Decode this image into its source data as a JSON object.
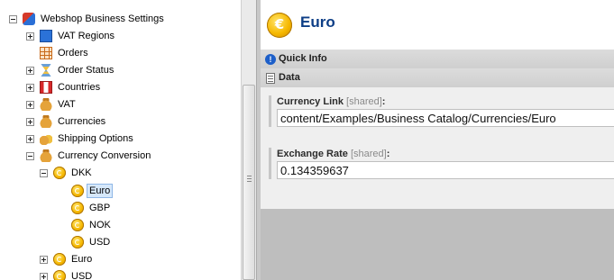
{
  "tree": {
    "items": [
      {
        "label": "Webshop Business Settings",
        "expander": "minus",
        "icon": "settings-icon"
      },
      {
        "label": "VAT Regions",
        "expander": "plus",
        "icon": "vat-regions-icon"
      },
      {
        "label": "Orders",
        "expander": "none",
        "icon": "orders-icon"
      },
      {
        "label": "Order Status",
        "expander": "plus",
        "icon": "order-status-icon"
      },
      {
        "label": "Countries",
        "expander": "plus",
        "icon": "countries-icon"
      },
      {
        "label": "VAT",
        "expander": "plus",
        "icon": "vat-icon"
      },
      {
        "label": "Currencies",
        "expander": "plus",
        "icon": "currencies-icon"
      },
      {
        "label": "Shipping Options",
        "expander": "plus",
        "icon": "shipping-options-icon"
      },
      {
        "label": "Currency Conversion",
        "expander": "minus",
        "icon": "currency-conversion-icon"
      },
      {
        "label": "DKK",
        "expander": "minus",
        "icon": "coin-icon"
      },
      {
        "label": "Euro",
        "expander": "none",
        "icon": "coin-icon",
        "selected": true
      },
      {
        "label": "GBP",
        "expander": "none",
        "icon": "coin-icon"
      },
      {
        "label": "NOK",
        "expander": "none",
        "icon": "coin-icon"
      },
      {
        "label": "USD",
        "expander": "none",
        "icon": "coin-icon"
      },
      {
        "label": "Euro",
        "expander": "plus",
        "icon": "coin-icon"
      },
      {
        "label": "USD",
        "expander": "plus",
        "icon": "coin-icon"
      }
    ]
  },
  "header": {
    "title": "Euro",
    "icon": "euro-coin-icon"
  },
  "sections": {
    "quick_info": "Quick Info",
    "data": "Data"
  },
  "fields": {
    "currency_link": {
      "label": "Currency Link",
      "shared": "[shared]",
      "colon": ":",
      "value": "content/Examples/Business Catalog/Currencies/Euro"
    },
    "exchange_rate": {
      "label": "Exchange Rate",
      "shared": "[shared]",
      "colon": ":",
      "value": "0.134359637"
    }
  },
  "colors": {
    "title": "#0d3e86",
    "selection": "#d6e8fb",
    "panel_background": "#bebebe"
  }
}
